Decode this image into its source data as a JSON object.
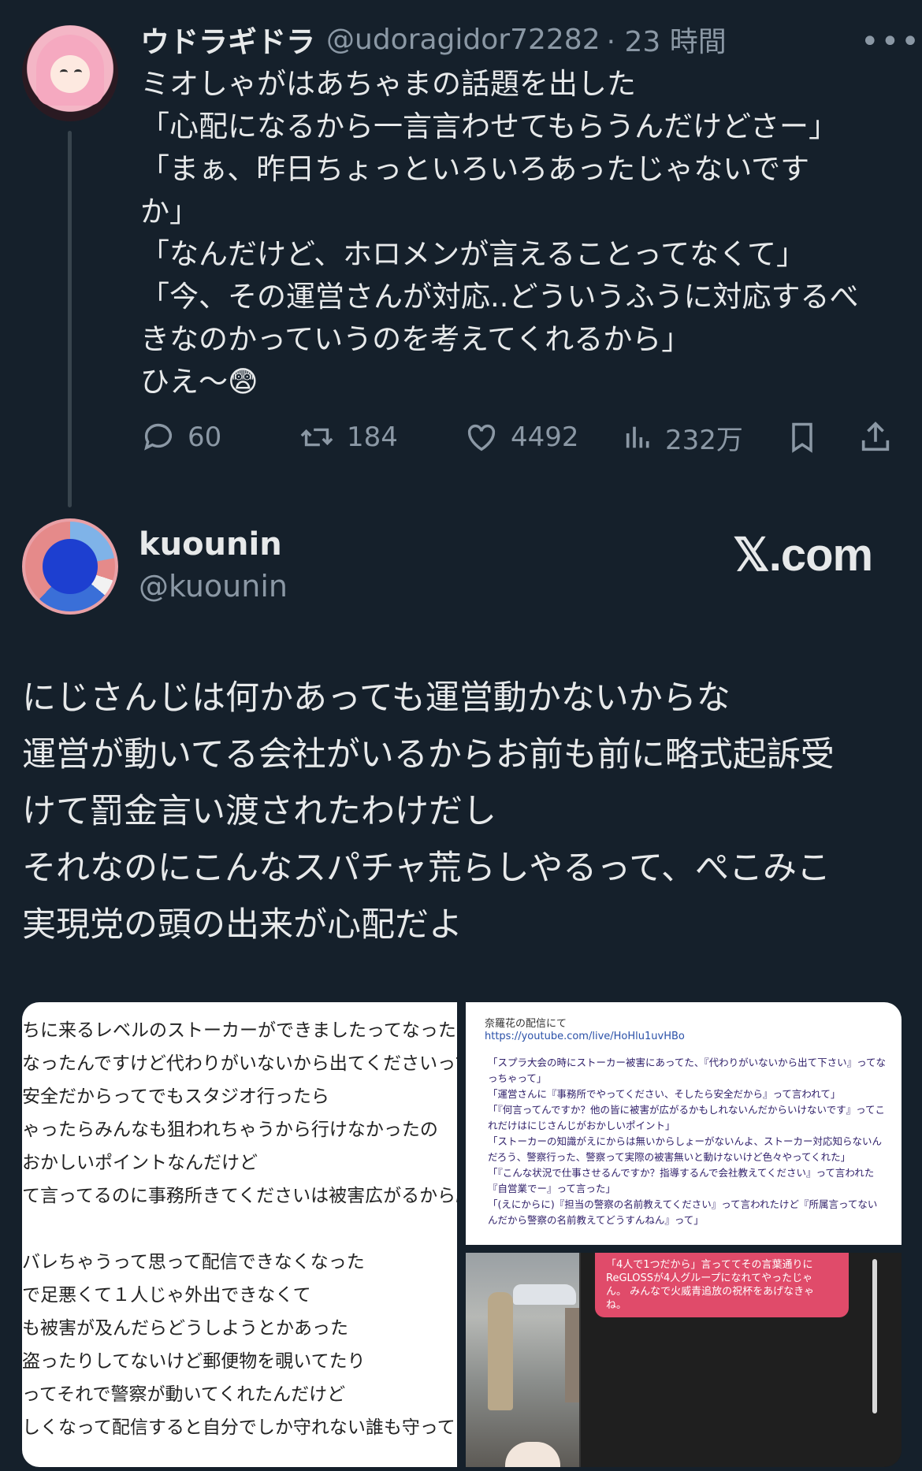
{
  "tweet1": {
    "name": "ウドラギドラ",
    "handle": "@udoragidor72282",
    "time": "· 23 時間",
    "more_icon": "more-dots-icon",
    "lines": [
      "ミオしゃがはあちゃまの話題を出した",
      "「心配になるから一言言わせてもらうんだけどさー」",
      "「まぁ、昨日ちょっといろいろあったじゃないです",
      "か」",
      "「なんだけど、ホロメンが言えることってなくて」",
      "「今、その運営さんが対応..どういうふうに対応するべ",
      "きなのかっていうのを考えてくれるから」",
      "ひえ〜😨"
    ],
    "actions": {
      "replies": "60",
      "retweets": "184",
      "likes": "4492",
      "views": "232万"
    }
  },
  "tweet2": {
    "name": "kuounin",
    "handle": "@kuounin",
    "brand": "𝕏.com",
    "lines": [
      "にじさんじは何かあっても運営動かないからな",
      "運営が動いてる会社がいるからお前も前に略式起訴受",
      "けて罰金言い渡されたわけだし",
      "それなのにこんなスパチャ荒らしやるって、ぺこみこ",
      "実現党の頭の出来が心配だよ"
    ],
    "image_left_lines": [
      "ちに来るレベルのストーカーができましたってなったら配",
      "なったんですけど代わりがいないから出てくださいって",
      "安全だからってでもスタジオ行ったら",
      "ゃったらみんなも狙われちゃうから行けなかったの",
      "おかしいポイントなんだけど",
      "て言ってるのに事務所きてくださいは被害広がるから駄",
      "",
      "バレちゃうって思って配信できなくなった",
      "で足悪くて１人じゃ外出できなくて",
      "も被害が及んだらどうしようとかあった",
      "盗ったりしてないけど郵便物を覗いてたり",
      "ってそれで警察が動いてくれたんだけど",
      "しくなって配信すると自分でしか守れない誰も守ってく"
    ],
    "image_tr_header": "奈羅花の配信にて",
    "image_tr_url": "https://youtube.com/live/HoHlu1uvHBo",
    "image_tr_lines": [
      "「スプラ大会の時にストーカー被害にあってた、『代わりがいないから出て下さい』ってな",
      "っちゃって」",
      "「運営さんに『事務所でやってください、そしたら安全だから』って言われて」",
      "「『何言ってんですか？他の皆に被害が広がるかもしれないんだからいけないです』ってこ",
      "れだけはにじさんじがおかしいポイント」",
      "「ストーカーの知識がえにからは無いからしょーがないんよ、ストーカー対応知らないん",
      "だろう、警察行った、警察って実際の被害無いと動けないけど色々やってくれた」",
      "「『こんな状況で仕事させるんですか？指導するんで会社教えてください』って言われた",
      "『自営業でー』って言った」",
      "「(えにからに)『担当の警察の名前教えてください』って言われたけど『所属言ってない",
      "んだから警察の名前教えてどうすんねん』って」"
    ],
    "image_br_bubble": [
      "「4人で1つだから」言っててその言葉通りに",
      "ReGLOSSが4人グループになれてやったじゃ",
      "ん。 みんなで火威青追放の祝杯をあげなきゃ",
      "ね。"
    ]
  }
}
